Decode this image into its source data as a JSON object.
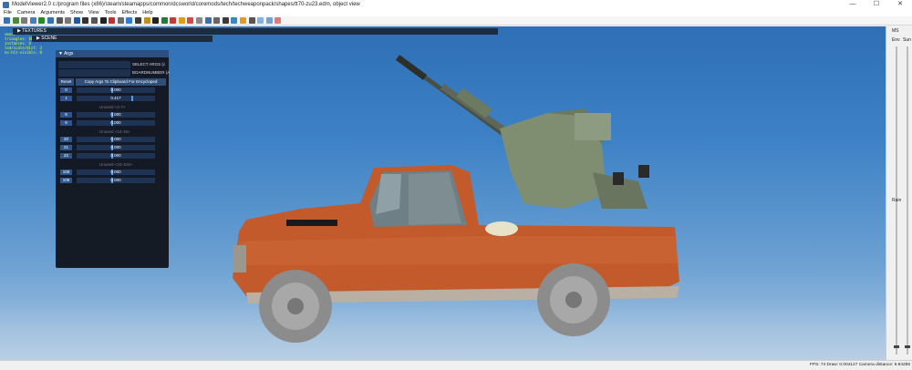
{
  "window": {
    "title": "ModelViewer2.0 c:/program files (x86)/steam/steamapps/common/dcsworld/coremods/tech/techweaponpack/shapes/tt70-zu23.edm, object view",
    "minimize": "—",
    "maximize": "☐",
    "close": "✕"
  },
  "menu": [
    "File",
    "Camera",
    "Arguments",
    "Show",
    "View",
    "Tools",
    "Effects",
    "Help"
  ],
  "toolbar_icon_colors": [
    "#3a6fb0",
    "#4a8a3a",
    "#7a7a7a",
    "#4a7abf",
    "#2a8a2a",
    "#3a6fb0",
    "#555",
    "#777",
    "#1c5aa8",
    "#333",
    "#555",
    "#222",
    "#c23030",
    "#6a6a6a",
    "#2e7dd1",
    "#3b3b3b",
    "#bf8f20",
    "#222",
    "#1a7f3a",
    "#c23b3b",
    "#d4a017",
    "#d44a4a",
    "#888",
    "#3a6fb0",
    "#666",
    "#3a3a3a",
    "#2e8bd1",
    "#e39b20",
    "#555",
    "#8ab0e0",
    "#7aa0d0",
    "#e07a7a"
  ],
  "stats": [
    "vmode",
    "triangles: 88824",
    "instances: 0",
    "lod/scale/dist: 3",
    "no-hit-visible: 0"
  ],
  "panels": {
    "textures": "TEXTURES",
    "scene": "SCENE"
  },
  "args": {
    "title": "Args",
    "select_args": "SELECT ARGS (c",
    "boardnumber": "BOARDNUMBER (A",
    "reset": "Reset",
    "copy": "Copy Args To Clipboard For Encycloped",
    "rows": [
      {
        "id": "0",
        "value": "0.000"
      },
      {
        "id": "1",
        "value": "0.417"
      },
      {
        "section": "Unused <2-7>"
      },
      {
        "id": "8",
        "value": "0.000"
      },
      {
        "id": "9",
        "value": "0.000"
      },
      {
        "section": "Unused <10-19>"
      },
      {
        "id": "20",
        "value": "0.000"
      },
      {
        "id": "21",
        "value": "0.000"
      },
      {
        "id": "22",
        "value": "0.000"
      },
      {
        "section": "Unused <23-104>"
      },
      {
        "id": "105",
        "value": "0.000"
      },
      {
        "id": "106",
        "value": "0.000"
      }
    ]
  },
  "sidebar": {
    "title": "MS",
    "env": "Env",
    "sun": "Sun",
    "rain": "Rain",
    "sun_level": 0.97,
    "env_level": 0.97
  },
  "status": "FPS: 74  Draw: 0.004127  Camera distance: 9.84286"
}
